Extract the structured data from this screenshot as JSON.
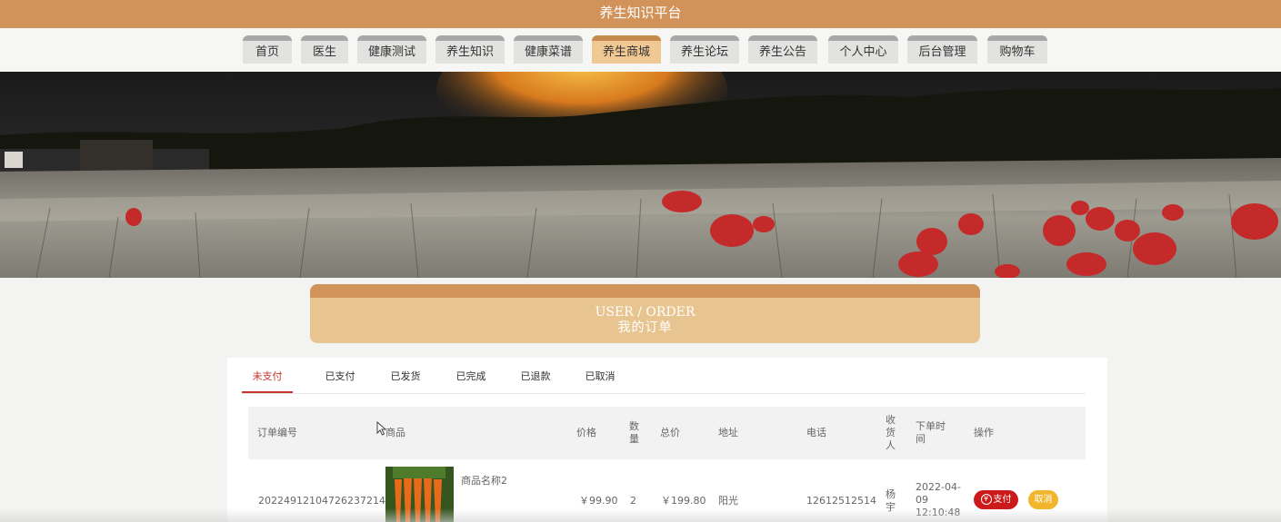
{
  "site": {
    "title": "养生知识平台"
  },
  "nav": {
    "items": [
      "首页",
      "医生",
      "健康测试",
      "养生知识",
      "健康菜谱",
      "养生商城",
      "养生论坛",
      "养生公告",
      "个人中心",
      "后台管理",
      "购物车"
    ],
    "active": "养生商城"
  },
  "section": {
    "title_en": "USER / ORDER",
    "title_zh": "我的订单"
  },
  "tabs": {
    "items": [
      "未支付",
      "已支付",
      "已发货",
      "已完成",
      "已退款",
      "已取消"
    ],
    "active": "未支付"
  },
  "table": {
    "headers": {
      "order_no": "订单编号",
      "product": "商品",
      "price": "价格",
      "qty": "数量",
      "total": "总价",
      "address": "地址",
      "phone": "电话",
      "receiver": "收货人",
      "order_time": "下单时间",
      "actions": "操作"
    },
    "rows": [
      {
        "order_no": "20224912104726237214",
        "product_name": "商品名称2",
        "product_image_icon": "carrot-image",
        "price": "￥99.90",
        "qty": "2",
        "total": "￥199.80",
        "address": "阳光",
        "phone": "12612512514",
        "receiver": "杨宇",
        "order_time": "2022-04-09 12:10:48",
        "pay_label": "支付",
        "cancel_label": "取消"
      }
    ]
  },
  "colors": {
    "brand": "#d2935a",
    "header_fill": "#e8c590",
    "active_tab": "#c8352b",
    "pay_button": "#cc1a1a",
    "cancel_button": "#f1b62b"
  }
}
